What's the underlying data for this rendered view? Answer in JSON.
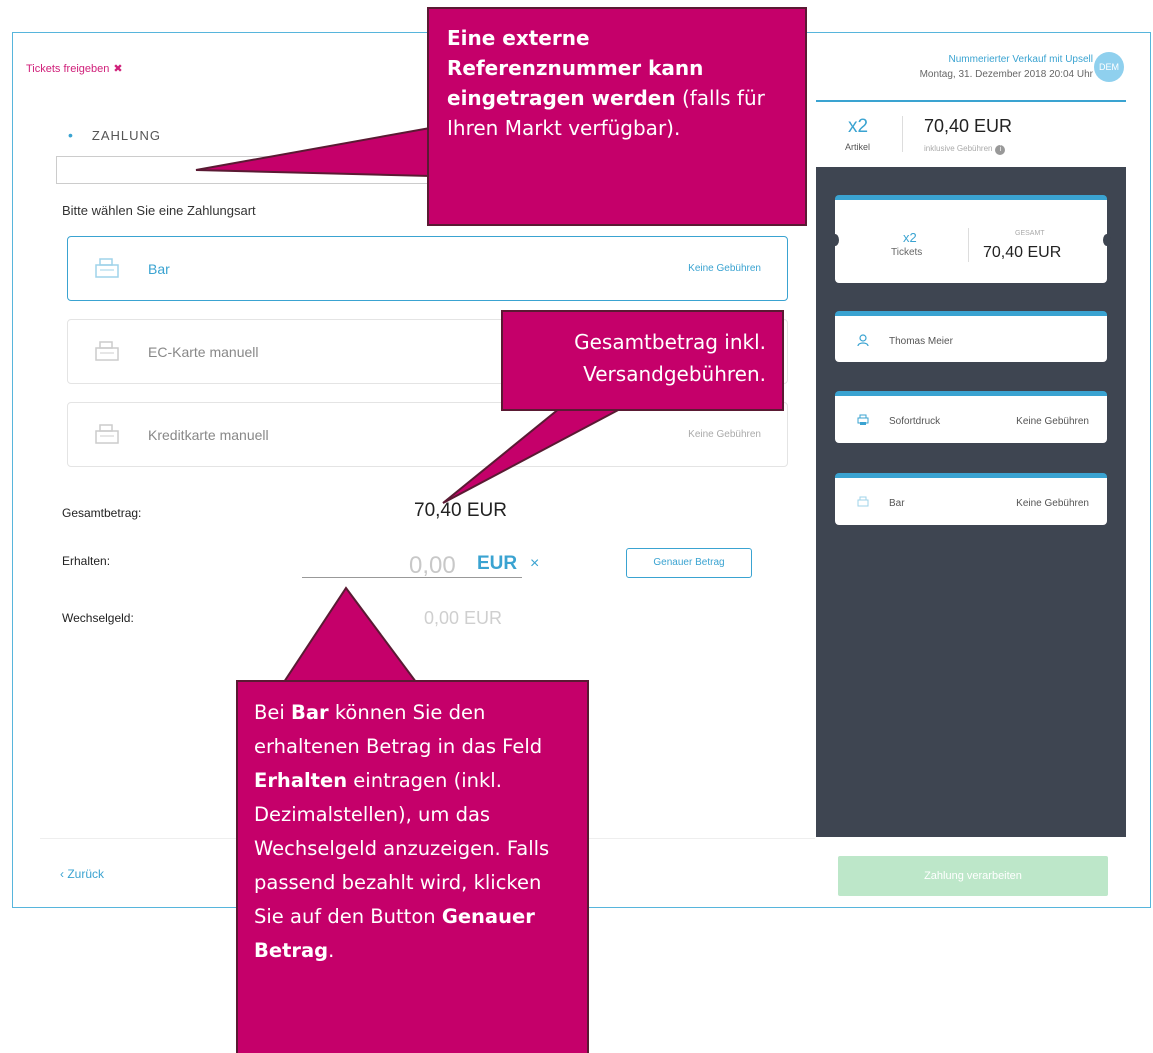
{
  "header": {
    "release_label": "Tickets freigeben",
    "release_x": "✖",
    "event_title": "Nummerierter Verkauf mit Upsell",
    "event_date": "Montag, 31. Dezember 2018 20:04 Uhr",
    "avatar_text": "DEM"
  },
  "payment": {
    "section_title": "ZAHLUNG",
    "choose_label": "Bitte wählen Sie eine Zahlungsart",
    "options": [
      {
        "name": "Bar",
        "fee": "Keine Gebühren",
        "icon": "cash-register-icon"
      },
      {
        "name": "EC-Karte manuell",
        "fee": "",
        "icon": "cash-register-icon"
      },
      {
        "name": "Kreditkarte manuell",
        "fee": "Keine Gebühren",
        "icon": "cash-register-icon"
      }
    ],
    "total_label": "Gesamtbetrag:",
    "total_value": "70,40 EUR",
    "received_label": "Erhalten:",
    "received_value": "0,00",
    "received_currency": "EUR",
    "received_clear": "×",
    "exact_button": "Genauer Betrag",
    "change_label": "Wechselgeld:",
    "change_value": "0,00 EUR"
  },
  "footer": {
    "back_label": "‹ Zurück",
    "process_button": "Zahlung verarbeiten"
  },
  "summary": {
    "count": "x2",
    "count_label": "Artikel",
    "total": "70,40 EUR",
    "total_sub": "inklusive Gebühren",
    "tickets_card": {
      "count": "x2",
      "count_label": "Tickets",
      "total_label": "GESAMT",
      "total": "70,40 EUR"
    },
    "customer_card": {
      "name": "Thomas Meier",
      "icon": "user-icon"
    },
    "delivery_card": {
      "method": "Sofortdruck",
      "fee": "Keine Gebühren",
      "icon": "printer-icon"
    },
    "payment_card": {
      "method": "Bar",
      "fee": "Keine Gebühren",
      "icon": "cash-icon"
    }
  },
  "callouts": {
    "top": {
      "bold": "Eine externe Referenznummer kann eingetragen werden",
      "rest": "(falls für Ihren Markt verfügbar)."
    },
    "middle": {
      "text": "Gesamtbetrag inkl. Versandgebühren."
    },
    "bottom": {
      "p1": "Bei ",
      "b1": "Bar",
      "p2": " können Sie den erhaltenen Betrag in das Feld ",
      "b2": "Erhalten",
      "p3": " eintragen (inkl. Dezimalstellen), um das Wechselgeld anzuzeigen. Falls passend bezahlt wird, klicken Sie auf den Button ",
      "b3": "Genauer Betrag",
      "p4": "."
    }
  },
  "colors": {
    "accent": "#3aa3d1",
    "callout": "#c5006a",
    "sidebar": "#3e4551",
    "process_button": "#bde7c9"
  }
}
